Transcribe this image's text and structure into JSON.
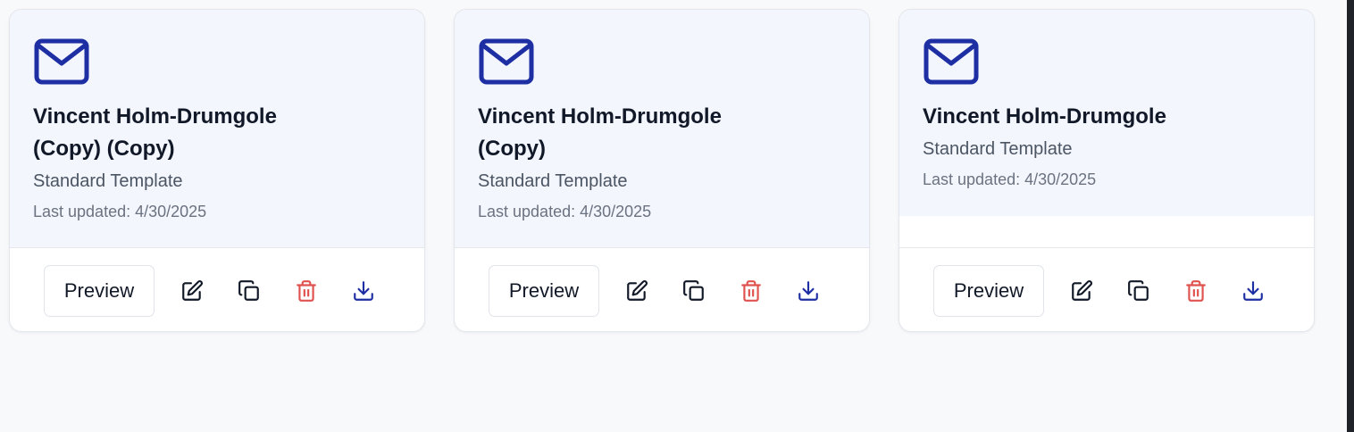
{
  "colors": {
    "accent": "#1e2fa3",
    "danger": "#e0524f",
    "text": "#111827",
    "card_header_bg": "#f3f6fd"
  },
  "cards": [
    {
      "icon": "mail-icon",
      "title": "Vincent Holm-Drumgole (Copy) (Copy)",
      "subtitle": "Standard Template",
      "updated": "Last updated: 4/30/2025",
      "preview_label": "Preview"
    },
    {
      "icon": "mail-icon",
      "title": "Vincent Holm-Drumgole (Copy)",
      "subtitle": "Standard Template",
      "updated": "Last updated: 4/30/2025",
      "preview_label": "Preview"
    },
    {
      "icon": "mail-icon",
      "title": "Vincent Holm-Drumgole",
      "subtitle": "Standard Template",
      "updated": "Last updated: 4/30/2025",
      "preview_label": "Preview"
    }
  ]
}
